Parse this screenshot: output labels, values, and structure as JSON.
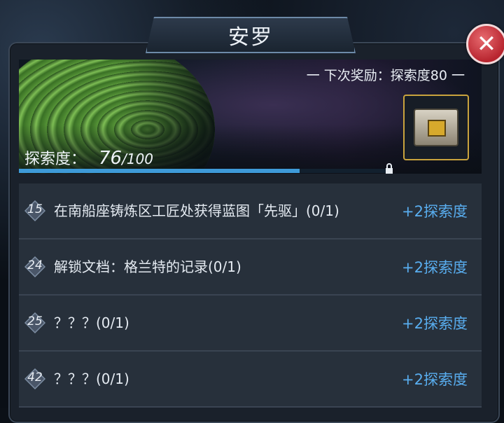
{
  "title": "安罗",
  "close_label": "✕",
  "banner": {
    "next_reward": "一  下次奖励：探索度80  一",
    "progress_label": "探索度：",
    "progress_value": "76",
    "progress_max": "/100",
    "progress_fraction": 0.76
  },
  "tasks": [
    {
      "num": "15",
      "text": "在南船座铸炼区工匠处获得蓝图「先驱」(0/1)",
      "reward": "+2探索度"
    },
    {
      "num": "24",
      "text": "解锁文档：格兰特的记录(0/1)",
      "reward": "+2探索度"
    },
    {
      "num": "25",
      "text": "？？？(0/1)",
      "reward": "+2探索度"
    },
    {
      "num": "42",
      "text": "？？？(0/1)",
      "reward": "+2探索度"
    }
  ]
}
